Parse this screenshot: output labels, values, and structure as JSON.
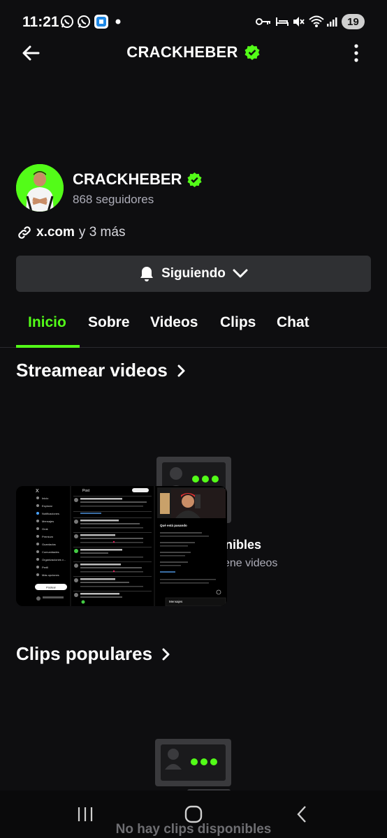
{
  "status_bar": {
    "time": "11:21",
    "battery": "19"
  },
  "header": {
    "title": "CRACKHEBER"
  },
  "profile": {
    "name": "CRACKHEBER",
    "followers": "868 seguidores",
    "link_primary": "x.com",
    "link_more": "y 3 más",
    "follow_button": "Siguiendo"
  },
  "tabs": [
    "Inicio",
    "Sobre",
    "Videos",
    "Clips",
    "Chat"
  ],
  "sections": {
    "videos_title": "Streamear videos",
    "videos_empty_title": "ponibles",
    "videos_empty_sub": "ene videos",
    "clips_title": "Clips populares",
    "clips_empty_title": "No hay clips disponibles"
  },
  "overlay": {
    "post_header": "Post",
    "sidebar": [
      "Inicio",
      "Explorar",
      "Notificaciones",
      "Mensajes",
      "Grok",
      "Premium",
      "Guardados",
      "Comunidades",
      "Organizaciones v...",
      "Perfil",
      "Más opciones"
    ],
    "post_button": "Postear",
    "trending_title": "Qué está pasando",
    "messages": "Mensajes"
  },
  "colors": {
    "accent": "#53fc18",
    "background": "#0e0e10",
    "button_bg": "#2f3033"
  },
  "icons": {
    "verified": "verified-badge-icon",
    "link": "link-icon",
    "bell": "bell-icon",
    "chevron": "chevron-down-icon"
  }
}
